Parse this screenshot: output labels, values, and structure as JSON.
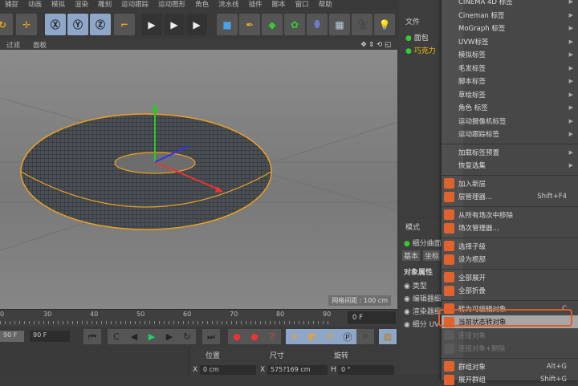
{
  "menubar": [
    "捕捉",
    "动画",
    "模拟",
    "渲染",
    "雕刻",
    "运动跟踪",
    "运动图形",
    "角色",
    "流水线",
    "插件",
    "脚本",
    "窗口",
    "帮助"
  ],
  "viewport": {
    "tabs": [
      "过滤",
      "面板"
    ],
    "grid_label": "网格间距 : 100 cm"
  },
  "timeline": {
    "ticks": [
      "0",
      "30",
      "40",
      "50",
      "60",
      "70",
      "80",
      "90"
    ],
    "current_frame": "0 F",
    "end_frame_a": "90 F",
    "end_frame_b": "90 F"
  },
  "coords": {
    "headers": [
      "位置",
      "尺寸",
      "旋转"
    ],
    "x_pos": "0 cm",
    "x_size": "575?169 cm",
    "h_rot": "0 °",
    "x_label": "X",
    "h_label": "H"
  },
  "objects": {
    "tab": "文件",
    "items": [
      "面包",
      "巧克力"
    ]
  },
  "attributes": {
    "tab": "模式",
    "object": "细分曲面",
    "tabs": [
      "基本",
      "坐标"
    ],
    "section": "对象属性",
    "props": [
      "类型",
      "编辑器细分",
      "渲染器细分",
      "细分 UV"
    ]
  },
  "context_menu": {
    "group1": [
      "CINEMA 4D 标签",
      "Cineman 标签",
      "MoGraph 标签",
      "UVW标签",
      "模拟标签",
      "毛发标签",
      "脚本标签",
      "草绘标签",
      "角色 标签",
      "运动摄像机标签",
      "运动跟踪标签"
    ],
    "group2": [
      "加载标签预置",
      "恢复选集"
    ],
    "group3": [
      {
        "label": "加入新层",
        "shortcut": ""
      },
      {
        "label": "层管理器...",
        "shortcut": "Shift+F4"
      }
    ],
    "group4": [
      {
        "label": "从所有场次中移除"
      },
      {
        "label": "场次管理器..."
      }
    ],
    "group5": [
      {
        "label": "选择子级"
      },
      {
        "label": "设为根部"
      }
    ],
    "group6": [
      {
        "label": "全部展开"
      },
      {
        "label": "全部折叠"
      }
    ],
    "group7": [
      {
        "label": "转为可编辑对象",
        "shortcut": "C"
      },
      {
        "label": "当前状态转对象",
        "shortcut": "",
        "highlighted": true
      },
      {
        "label": "连接对象",
        "disabled": true
      },
      {
        "label": "连接对象+删除",
        "disabled": true
      }
    ],
    "group8": [
      {
        "label": "群组对象",
        "shortcut": "Alt+G"
      },
      {
        "label": "展开群组",
        "shortcut": "Shift+G"
      }
    ]
  },
  "colors": {
    "highlight_border": "#e35b24",
    "torus_outline": "#f0a020"
  }
}
